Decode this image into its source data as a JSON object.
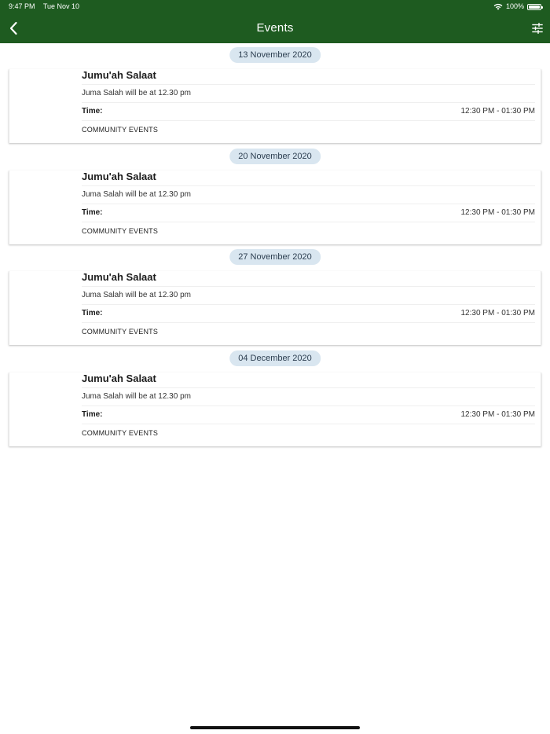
{
  "status_bar": {
    "time": "9:47 PM",
    "date": "Tue Nov 10",
    "battery": "100%"
  },
  "nav": {
    "title": "Events"
  },
  "events": [
    {
      "date": "13 November 2020",
      "title": "Jumu'ah Salaat",
      "description": "Juma Salah will be at 12.30 pm",
      "time_label": "Time:",
      "time_value": "12:30 PM - 01:30 PM",
      "category": "COMMUNITY EVENTS"
    },
    {
      "date": "20 November 2020",
      "title": "Jumu'ah Salaat",
      "description": "Juma Salah will be at 12.30 pm",
      "time_label": "Time:",
      "time_value": "12:30 PM - 01:30 PM",
      "category": "COMMUNITY EVENTS"
    },
    {
      "date": "27 November 2020",
      "title": "Jumu'ah Salaat",
      "description": "Juma Salah will be at 12.30 pm",
      "time_label": "Time:",
      "time_value": "12:30 PM - 01:30 PM",
      "category": "COMMUNITY EVENTS"
    },
    {
      "date": "04 December 2020",
      "title": "Jumu'ah Salaat",
      "description": "Juma Salah will be at 12.30 pm",
      "time_label": "Time:",
      "time_value": "12:30 PM - 01:30 PM",
      "category": "COMMUNITY EVENTS"
    }
  ],
  "icons": {
    "back": "chevron-left-icon",
    "filter": "sliders-icon",
    "wifi": "wifi-icon",
    "battery": "battery-icon"
  },
  "colors": {
    "header": "#1e5b20",
    "date_pill": "#d9e6f0"
  }
}
